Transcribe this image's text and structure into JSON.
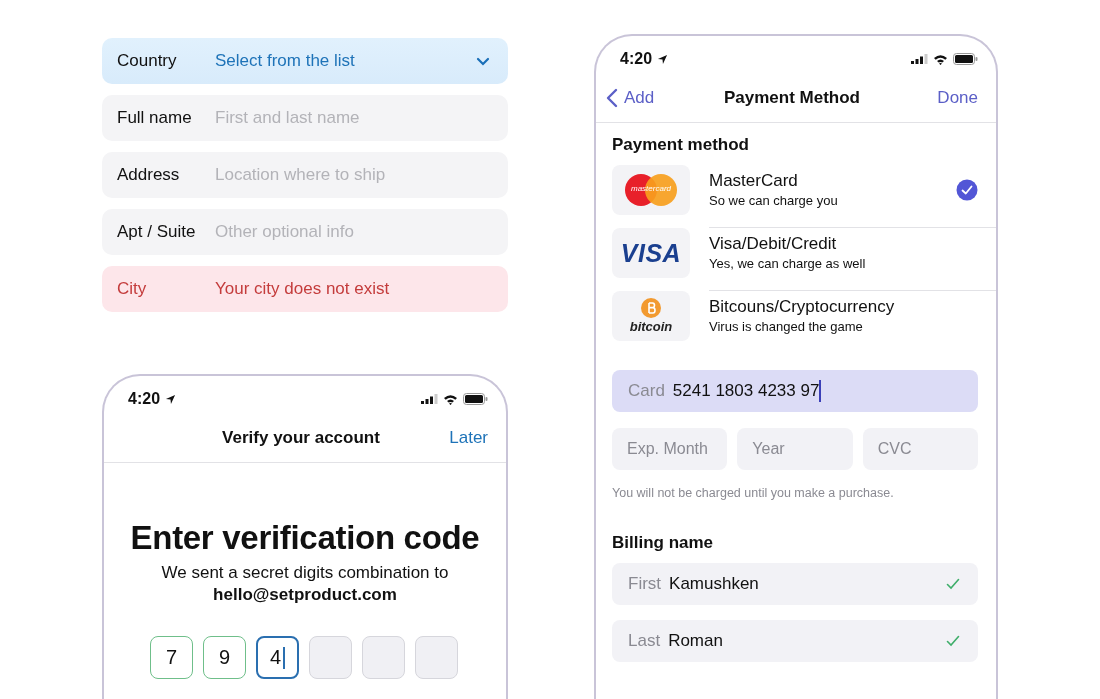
{
  "address_form": {
    "fields": [
      {
        "label": "Country",
        "placeholder": "Select from the list",
        "kind": "select",
        "error": false
      },
      {
        "label": "Full name",
        "placeholder": "First and last name",
        "kind": "text",
        "error": false
      },
      {
        "label": "Address",
        "placeholder": "Location where to ship",
        "kind": "text",
        "error": false
      },
      {
        "label": "Apt / Suite",
        "placeholder": "Other optional info",
        "kind": "text",
        "error": false
      },
      {
        "label": "City",
        "placeholder": "Your city does not exist",
        "kind": "text",
        "error": true
      }
    ]
  },
  "verify_screen": {
    "status_bar": {
      "time": "4:20"
    },
    "nav": {
      "title": "Verify your account",
      "action": "Later"
    },
    "heading": "Enter verification code",
    "message": "We sent a secret digits combination to",
    "email": "hello@setproduct.com",
    "code_digits": [
      {
        "value": "7",
        "kind": "filled"
      },
      {
        "value": "9",
        "kind": "filled"
      },
      {
        "value": "4",
        "kind": "active"
      },
      {
        "kind": "empty"
      },
      {
        "kind": "empty"
      },
      {
        "kind": "empty"
      }
    ]
  },
  "payment_screen": {
    "status_bar": {
      "time": "4:20"
    },
    "nav": {
      "back": "Add",
      "title": "Payment Method",
      "action": "Done"
    },
    "section_title": "Payment method",
    "methods": [
      {
        "kind": "mastercard",
        "logo_text": "mastercard",
        "name": "MasterCard",
        "description": "So we can charge you",
        "selected": true
      },
      {
        "kind": "visa",
        "logo_text": "VISA",
        "name": "Visa/Debit/Credit",
        "description": "Yes, we can charge as well",
        "selected": false
      },
      {
        "kind": "bitcoin",
        "logo_text": "bitcoin",
        "name": "Bitcouns/Cryptocurrency",
        "description": "Virus is changed the game",
        "selected": false
      }
    ],
    "card_field": {
      "label": "Card",
      "value": "5241 1803 4233 97",
      "focused": true
    },
    "expiry_fields": [
      {
        "placeholder": "Exp. Month"
      },
      {
        "placeholder": "Year"
      },
      {
        "placeholder": "CVC"
      }
    ],
    "note": "You will not be charged until you make a purchase.",
    "billing_title": "Billing name",
    "billing_fields": [
      {
        "label": "First",
        "value": "Kamushken",
        "valid": true
      },
      {
        "label": "Last",
        "value": "Roman",
        "valid": true
      }
    ]
  }
}
